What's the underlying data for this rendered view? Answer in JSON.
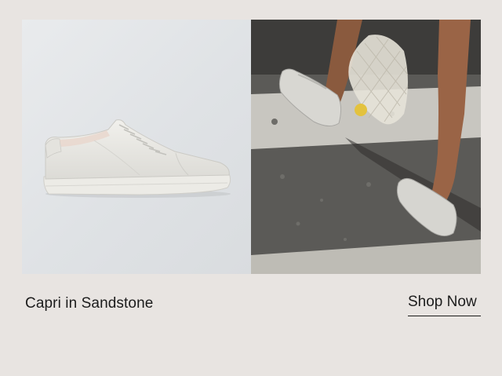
{
  "product": {
    "caption": "Capri in Sandstone",
    "cta_label": "Shop Now"
  },
  "images": {
    "left": "sneaker-product-photo",
    "right": "street-lifestyle-photo"
  },
  "colors": {
    "background": "#e8e4e1",
    "text": "#1c1c1c"
  }
}
